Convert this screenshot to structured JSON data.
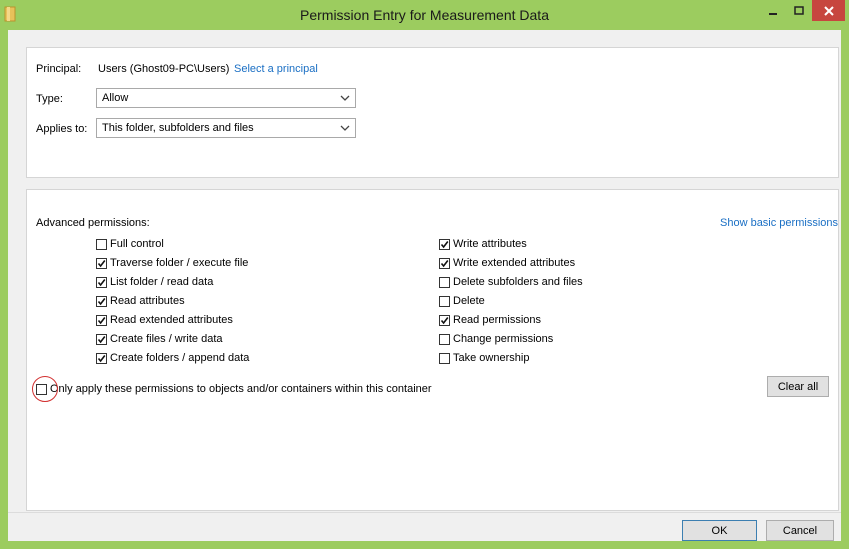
{
  "window": {
    "title": "Permission Entry for Measurement Data",
    "accent": "#9ccc5f"
  },
  "principal": {
    "label": "Principal:",
    "value": "Users (Ghost09-PC\\Users)",
    "link": "Select a principal"
  },
  "type": {
    "label": "Type:",
    "value": "Allow"
  },
  "applies_to": {
    "label": "Applies to:",
    "value": "This folder, subfolders and files"
  },
  "advanced": {
    "title": "Advanced permissions:",
    "show_basic_link": "Show basic permissions",
    "left_column": [
      {
        "label": "Full control",
        "checked": false
      },
      {
        "label": "Traverse folder / execute file",
        "checked": true
      },
      {
        "label": "List folder / read data",
        "checked": true
      },
      {
        "label": "Read attributes",
        "checked": true
      },
      {
        "label": "Read extended attributes",
        "checked": true
      },
      {
        "label": "Create files / write data",
        "checked": true
      },
      {
        "label": "Create folders / append data",
        "checked": true
      }
    ],
    "right_column": [
      {
        "label": "Write attributes",
        "checked": true
      },
      {
        "label": "Write extended attributes",
        "checked": true
      },
      {
        "label": "Delete subfolders and files",
        "checked": false
      },
      {
        "label": "Delete",
        "checked": false
      },
      {
        "label": "Read permissions",
        "checked": true
      },
      {
        "label": "Change permissions",
        "checked": false
      },
      {
        "label": "Take ownership",
        "checked": false
      }
    ],
    "only_apply": {
      "label": "Only apply these permissions to objects and/or containers within this container",
      "checked": false
    },
    "clear_all": "Clear all"
  },
  "buttons": {
    "ok": "OK",
    "cancel": "Cancel"
  }
}
